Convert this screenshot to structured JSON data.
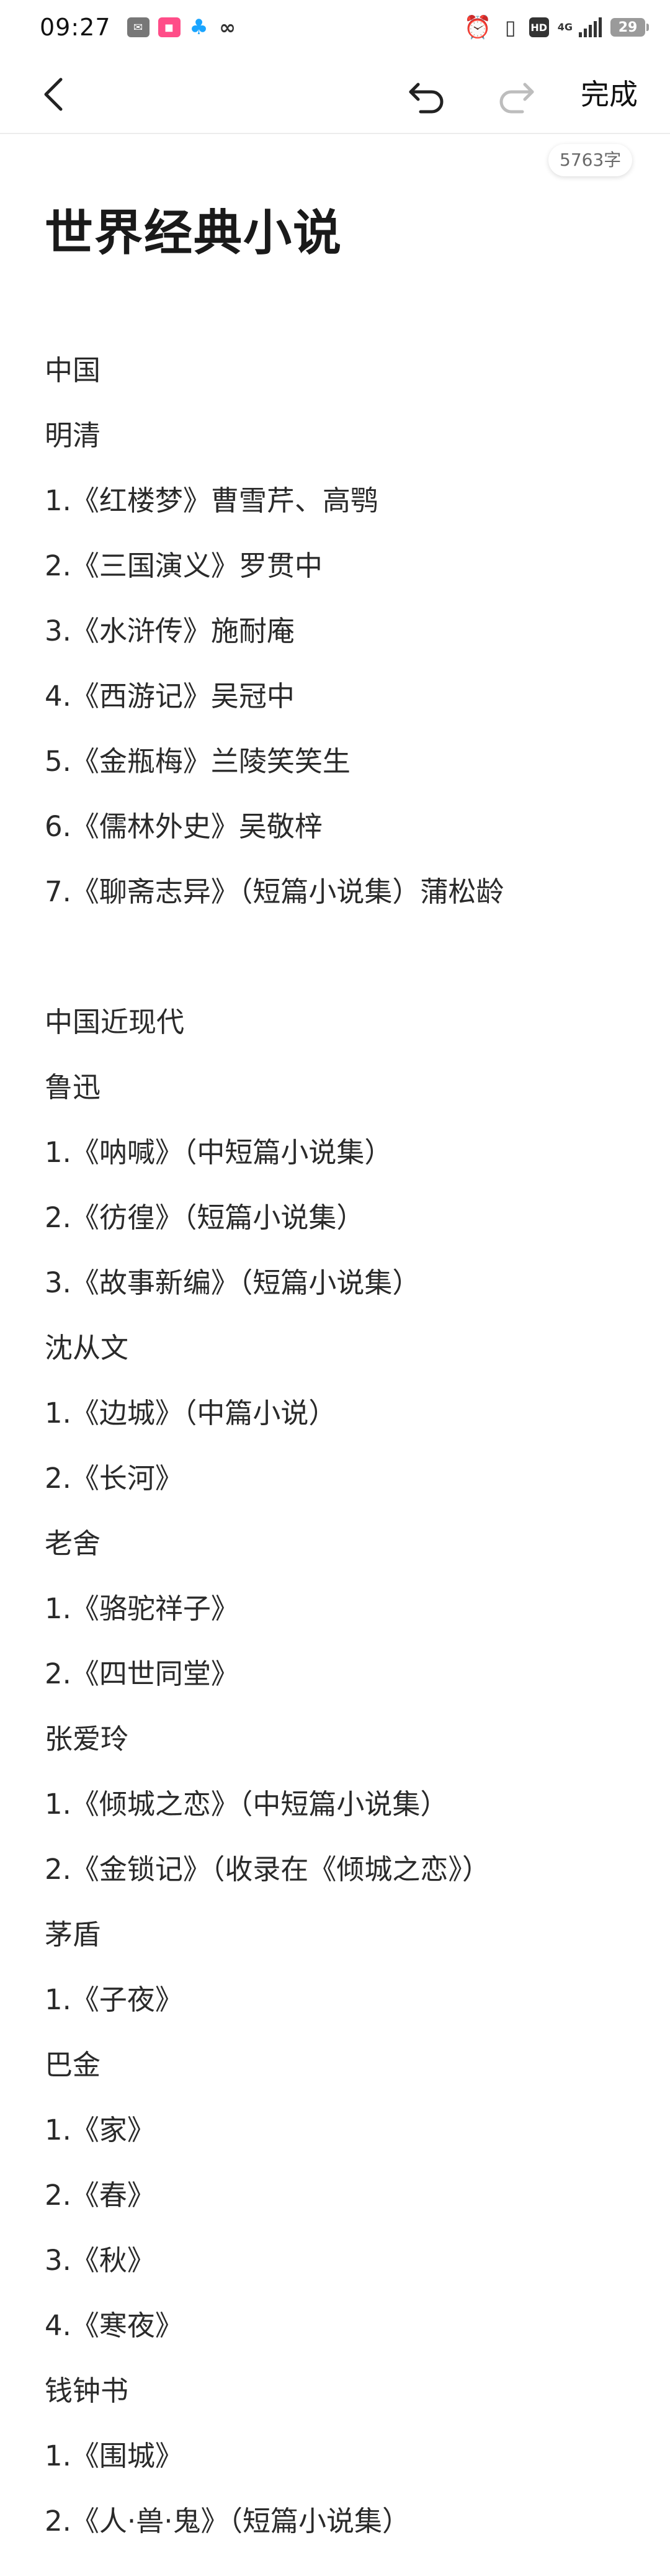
{
  "status_bar": {
    "time": "09:27",
    "battery": "29",
    "network": "4G"
  },
  "toolbar": {
    "done_label": "完成"
  },
  "document": {
    "word_count": "5763字",
    "title": "世界经典小说",
    "lines": [
      "中国",
      "明清",
      "1.《红楼梦》曹雪芹、高鹗",
      "2.《三国演义》罗贯中",
      "3.《水浒传》施耐庵",
      "4.《西游记》吴冠中",
      "5.《金瓶梅》兰陵笑笑生",
      "6.《儒林外史》吴敬梓",
      "7.《聊斋志异》（短篇小说集）蒲松龄",
      "",
      "中国近现代",
      "鲁迅",
      "1.《呐喊》（中短篇小说集）",
      "2.《彷徨》（短篇小说集）",
      "3.《故事新编》（短篇小说集）",
      "沈从文",
      "1.《边城》（中篇小说）",
      "2.《长河》",
      "老舍",
      "1.《骆驼祥子》",
      "2.《四世同堂》",
      "张爱玲",
      "1.《倾城之恋》（中短篇小说集）",
      "2.《金锁记》（收录在《倾城之恋》）",
      "茅盾",
      "1.《子夜》",
      "巴金",
      "1.《家》",
      "2.《春》",
      "3.《秋》",
      "4.《寒夜》",
      "钱钟书",
      "1.《围城》",
      "2.《人·兽·鬼》（短篇小说集）"
    ]
  }
}
